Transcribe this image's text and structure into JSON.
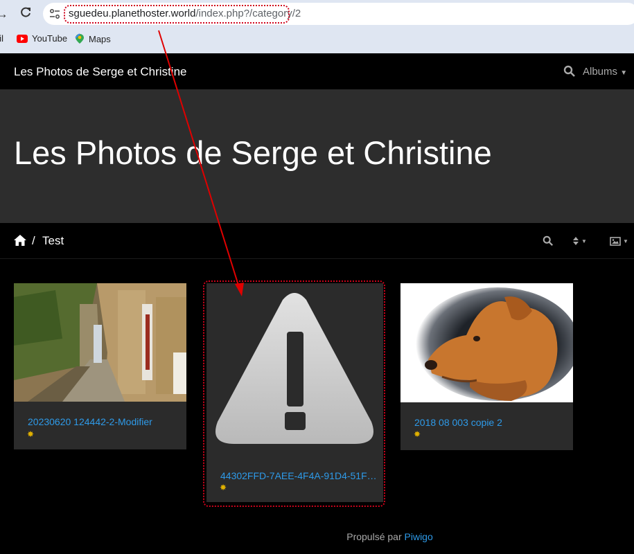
{
  "browser": {
    "url_host": "sguedeu.planethoster.world",
    "url_path": "/index.php?/category/2",
    "bookmarks": [
      {
        "label": "ail"
      },
      {
        "label": "YouTube"
      },
      {
        "label": "Maps"
      }
    ]
  },
  "navbar": {
    "brand": "Les Photos de Serge et Christine",
    "albums_label": "Albums"
  },
  "jumbotron": {
    "title": "Les Photos de Serge et Christine"
  },
  "breadcrumb": {
    "separator": "/",
    "current": "Test"
  },
  "thumbnails": [
    {
      "title": "20230620 124442-2-Modifier",
      "badge": "✸"
    },
    {
      "title": "44302FFD-7AEE-4F4A-91D4-51F…",
      "badge": "✸"
    },
    {
      "title": "2018 08 003 copie 2",
      "badge": "✸"
    }
  ],
  "footer": {
    "prefix": "Propulsé par",
    "link": "Piwigo"
  },
  "colors": {
    "link": "#2e9ae8",
    "annotation": "#d0021b",
    "card": "#2b2b2b",
    "jumbotron": "#2d2d2d"
  }
}
